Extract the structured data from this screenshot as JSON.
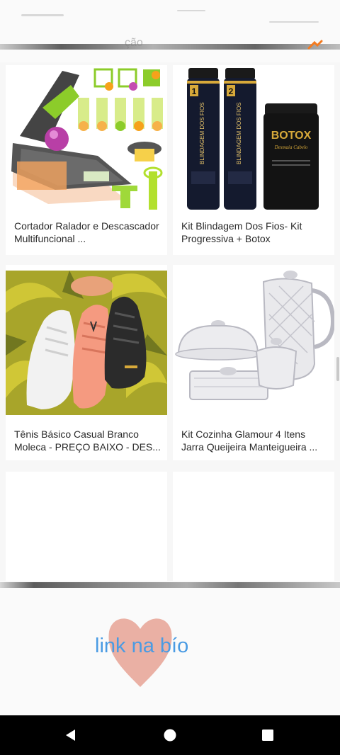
{
  "header": {
    "faint_text": "ção"
  },
  "products": [
    {
      "title": "Cortador Ralador e Descascador Multifuncional ...",
      "image": "vegetable-slicer-image"
    },
    {
      "title": "Kit Blindagem Dos Fios- Kit Progressiva + Botox",
      "image": "hair-treatment-kit-image",
      "labels": {
        "step1": "1",
        "step2": "2",
        "bottle_text": "BLINDAGEM DOS FIOS",
        "jar_brand": "BOTOX",
        "jar_sub": "Desmaia Cabelo"
      }
    },
    {
      "title": "Tênis Básico Casual Branco Moleca - PREÇO BAIXO - DES...",
      "image": "sneakers-image"
    },
    {
      "title": "Kit Cozinha Glamour 4 Itens Jarra Queijeira Manteigueira ...",
      "image": "glassware-kit-image"
    },
    {
      "title": "",
      "image": ""
    },
    {
      "title": "",
      "image": ""
    }
  ],
  "banner": {
    "text": "link na bío"
  },
  "colors": {
    "link_blue": "#4a9be3",
    "heart": "#e8a79a",
    "navbar": "#000000",
    "accent_orange": "#f47b20"
  },
  "navbar": {
    "icons": [
      "back-icon",
      "home-icon",
      "recents-icon"
    ]
  }
}
